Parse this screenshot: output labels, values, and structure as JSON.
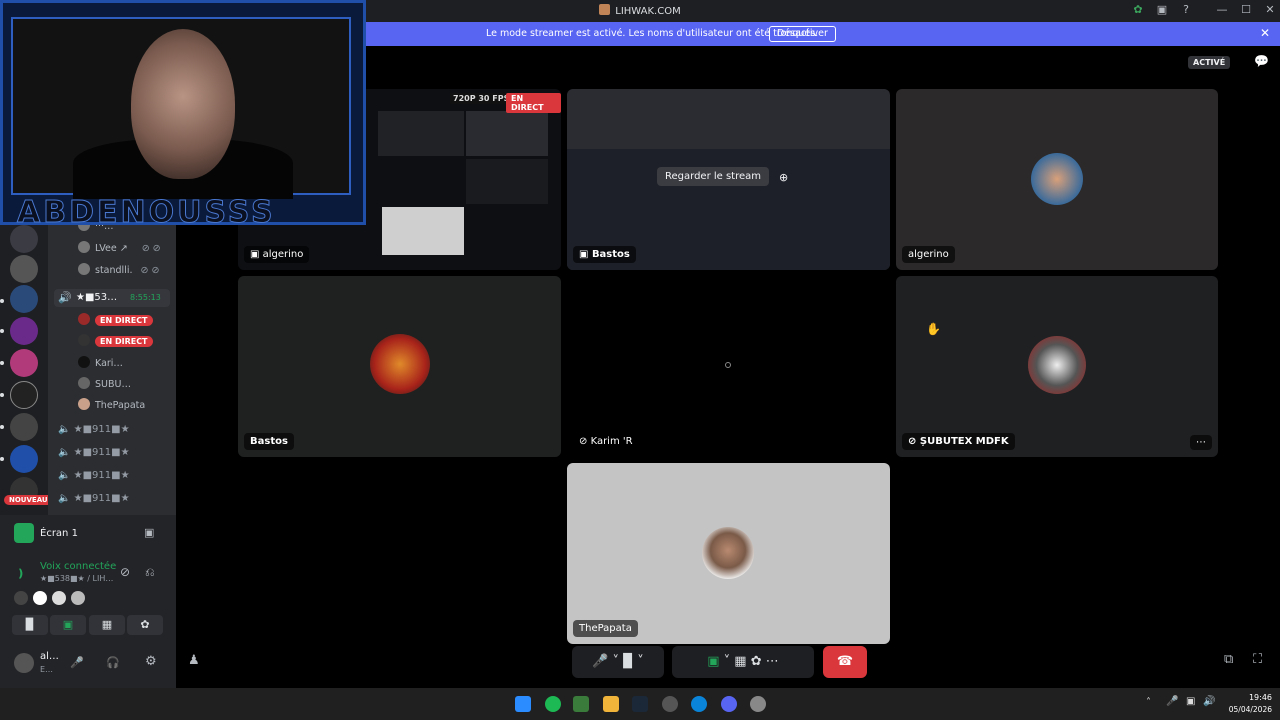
{
  "titlebar": {
    "title": "LIHWAK.COM",
    "window_buttons": [
      "—",
      "☐",
      "✕"
    ]
  },
  "banner": {
    "text": "Le mode streamer est activé. Les noms d'utilisateur ont été tronqués.",
    "button": "Désactiver"
  },
  "webcam": {
    "overlay_name": "ABDENOUSSS"
  },
  "channel_list": {
    "voice_users": [
      {
        "name": "···…"
      },
      {
        "name": "LVee ↗"
      },
      {
        "name": "standlli."
      }
    ],
    "active_channel": {
      "name": "★■53…",
      "timer": "8:55:13"
    },
    "live_badge": "EN DIRECT",
    "members": [
      {
        "name": "Kari…"
      },
      {
        "name": "SUBU…"
      },
      {
        "name": "ThePapata"
      }
    ],
    "other_channels": [
      "★■911■★",
      "★■911■★",
      "★■911■★",
      "★■911■★"
    ],
    "new_badge": "NOUVEAU"
  },
  "user_panel": {
    "screen_share": "Écran 1",
    "voice_status": "Voix connectée",
    "voice_channel": "★■538■★ / LIH…",
    "username": "al…",
    "user_status": "E…"
  },
  "stage": {
    "activity_badge": "ACTIVÉ",
    "tiles": [
      {
        "label": "algerino",
        "stream_quality": "720P 30 FPS",
        "live": "EN DIRECT"
      },
      {
        "label": "Bastos",
        "watch_button": "Regarder le stream"
      },
      {
        "label": "algerino"
      },
      {
        "label": "Bastos"
      },
      {
        "label": "Karim 'R"
      },
      {
        "label": "ȘUBUTEX MDFK"
      },
      {
        "label": "ThePapata"
      }
    ]
  },
  "taskbar": {
    "time": "19:46",
    "date": "05/04/2026"
  },
  "colors": {
    "accent": "#5865f2",
    "danger": "#da373c",
    "success": "#23a55a",
    "background": "#000000"
  },
  "icons": [
    "leaf-icon",
    "monitor-icon",
    "help-icon",
    "mic-icon",
    "camera-off-icon",
    "screen-share-icon",
    "activity-icon",
    "soundboard-icon",
    "more-icon",
    "hang-up-icon",
    "popout-icon",
    "fullscreen-icon"
  ]
}
